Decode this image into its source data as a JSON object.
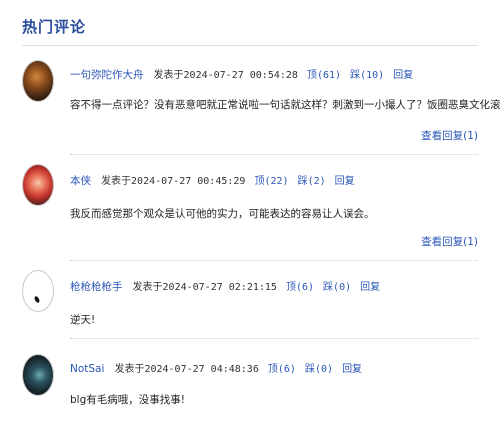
{
  "section_title": "热门评论",
  "posted_label": "发表于",
  "up_label": "顶",
  "down_label": "踩",
  "reply_label": "回复",
  "comments": [
    {
      "user": "一句弥陀作大舟",
      "time": "2024-07-27 00:54:28",
      "up": "(61)",
      "down": "(10)",
      "text": "容不得一点评论？没有恶意吧就正常说啦一句话就这样？刺激到一小撮人了？饭圈恶臭文化滚粗！",
      "more": "查看回复(1)"
    },
    {
      "user": "本侠",
      "time": "2024-07-27 00:45:29",
      "up": "(22)",
      "down": "(2)",
      "text": "我反而感觉那个观众是认可他的实力，可能表达的容易让人误会。",
      "more": "查看回复(1)"
    },
    {
      "user": "枪枪枪枪手",
      "time": "2024-07-27 02:21:15",
      "up": "(6)",
      "down": "(0)",
      "text": "逆天!"
    },
    {
      "user": "NotSai",
      "time": "2024-07-27 04:48:36",
      "up": "(6)",
      "down": "(0)",
      "text": "blg有毛病哦，没事找事!"
    }
  ]
}
